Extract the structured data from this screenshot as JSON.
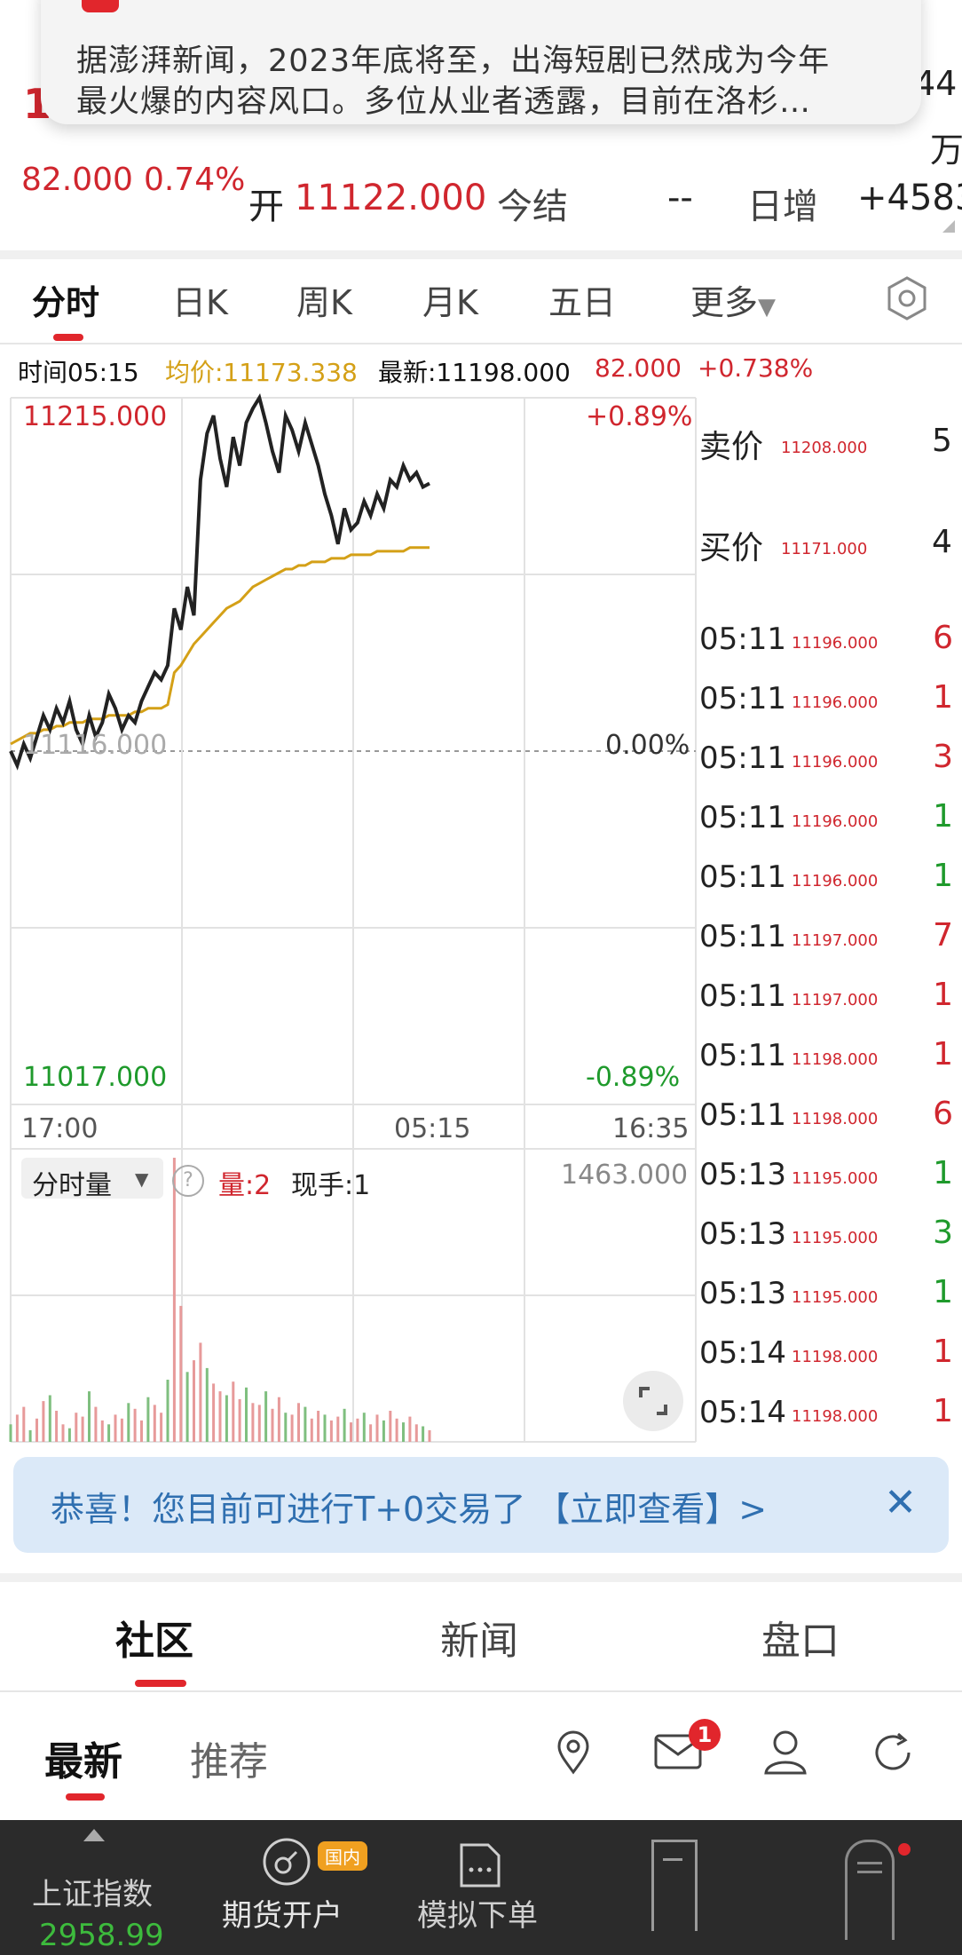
{
  "notification": {
    "line1": "据澎湃新闻，2023年底将至，出海短剧已然成为今年",
    "line2": "最火爆的内容风口。多位从业者透露，目前在洛杉…"
  },
  "quote": {
    "price_partial": "1",
    "change": "82.000",
    "change_pct": "0.74%",
    "right_top": "44",
    "right_mid": "万",
    "open_label": "开",
    "open_value": "11122.000",
    "settle_label": "今结",
    "settle_value": "--",
    "oi_label": "日增",
    "oi_value": "+4583"
  },
  "tabs": [
    "分时",
    "日K",
    "周K",
    "月K",
    "五日",
    "更多"
  ],
  "info_bar": {
    "time": "时间05:15",
    "avg": "均价:11173.338",
    "latest": "最新:11198.000",
    "change": "82.000",
    "change_pct": "+0.738%"
  },
  "chart_data": {
    "type": "line",
    "title": "",
    "x_ticks": [
      "17:00",
      "05:15",
      "16:35"
    ],
    "y_max": "11215.000",
    "y_min": "11017.000",
    "y_mid": "11116.000",
    "pct_max": "+0.89%",
    "pct_mid": "0.00%",
    "pct_min": "-0.89%",
    "ylim": [
      11017,
      11215
    ],
    "series": [
      {
        "color": "#222222",
        "values": [
          11116,
          11112,
          11118,
          11114,
          11120,
          11126,
          11122,
          11128,
          11124,
          11130,
          11122,
          11118,
          11126,
          11120,
          11124,
          11132,
          11128,
          11122,
          11126,
          11124,
          11130,
          11134,
          11138,
          11136,
          11140,
          11156,
          11150,
          11162,
          11154,
          11192,
          11205,
          11210,
          11198,
          11190,
          11204,
          11196,
          11208,
          11212,
          11215,
          11208,
          11200,
          11194,
          11210,
          11206,
          11200,
          11208,
          11202,
          11196,
          11188,
          11182,
          11174,
          11184,
          11178,
          11180,
          11186,
          11182,
          11188,
          11184,
          11192,
          11190,
          11196,
          11192,
          11194,
          11190,
          11191
        ]
      },
      {
        "color": "#d4a017",
        "values": [
          11118,
          11119,
          11120,
          11121,
          11121,
          11122,
          11122,
          11123,
          11123,
          11124,
          11124,
          11124,
          11125,
          11125,
          11125,
          11126,
          11126,
          11126,
          11126,
          11127,
          11127,
          11128,
          11128,
          11128,
          11129,
          11138,
          11140,
          11143,
          11146,
          11148,
          11150,
          11152,
          11154,
          11156,
          11157,
          11158,
          11160,
          11162,
          11163,
          11164,
          11165,
          11166,
          11167,
          11167,
          11168,
          11168,
          11169,
          11169,
          11169,
          11170,
          11170,
          11170,
          11171,
          11171,
          11171,
          11171,
          11172,
          11172,
          11172,
          11172,
          11172,
          11173,
          11173,
          11173,
          11173
        ]
      }
    ],
    "volume": {
      "label": "分时量",
      "qty_label": "量:2",
      "hand_label": "现手:1",
      "max_label": "1463.000",
      "values": [
        90,
        140,
        180,
        60,
        120,
        210,
        240,
        160,
        90,
        70,
        150,
        130,
        260,
        180,
        110,
        90,
        140,
        120,
        200,
        170,
        110,
        230,
        190,
        150,
        320,
        1463,
        700,
        360,
        420,
        510,
        380,
        300,
        260,
        240,
        310,
        220,
        280,
        200,
        190,
        260,
        170,
        230,
        150,
        140,
        200,
        180,
        120,
        160,
        140,
        110,
        130,
        170,
        100,
        120,
        150,
        90,
        140,
        110,
        160,
        120,
        100,
        130,
        90,
        80,
        60
      ]
    }
  },
  "order_book": {
    "ask_label": "卖价",
    "ask_price": "11208.000",
    "ask_vol": "5",
    "bid_label": "买价",
    "bid_price": "11171.000",
    "bid_vol": "4"
  },
  "trades": [
    {
      "time": "05:11",
      "price": "11196.000",
      "vol": "6",
      "color": "#d0262e"
    },
    {
      "time": "05:11",
      "price": "11196.000",
      "vol": "1",
      "color": "#d0262e"
    },
    {
      "time": "05:11",
      "price": "11196.000",
      "vol": "3",
      "color": "#d0262e"
    },
    {
      "time": "05:11",
      "price": "11196.000",
      "vol": "1",
      "color": "#1f9a2c"
    },
    {
      "time": "05:11",
      "price": "11196.000",
      "vol": "1",
      "color": "#1f9a2c"
    },
    {
      "time": "05:11",
      "price": "11197.000",
      "vol": "7",
      "color": "#d0262e"
    },
    {
      "time": "05:11",
      "price": "11197.000",
      "vol": "1",
      "color": "#d0262e"
    },
    {
      "time": "05:11",
      "price": "11198.000",
      "vol": "1",
      "color": "#d0262e"
    },
    {
      "time": "05:11",
      "price": "11198.000",
      "vol": "6",
      "color": "#d0262e"
    },
    {
      "time": "05:13",
      "price": "11195.000",
      "vol": "1",
      "color": "#1f9a2c"
    },
    {
      "time": "05:13",
      "price": "11195.000",
      "vol": "3",
      "color": "#1f9a2c"
    },
    {
      "time": "05:13",
      "price": "11195.000",
      "vol": "1",
      "color": "#1f9a2c"
    },
    {
      "time": "05:14",
      "price": "11198.000",
      "vol": "1",
      "color": "#d0262e"
    },
    {
      "time": "05:14",
      "price": "11198.000",
      "vol": "1",
      "color": "#d0262e"
    }
  ],
  "banner": {
    "message": "恭喜！您目前可进行T+0交易了 【立即查看】>"
  },
  "community_tabs": [
    "社区",
    "新闻",
    "盘口"
  ],
  "sub_tabs": [
    "最新",
    "推荐"
  ],
  "badge_count": "1",
  "bottom_bar": {
    "index_name": "上证指数",
    "index_value": "2958.99",
    "open_account": "期货开户",
    "domestic_badge": "国内",
    "sim_order": "模拟下单"
  },
  "colors": {
    "up": "#d0262e",
    "down": "#1f9a2c",
    "avg_line": "#d4a017",
    "accent": "#e1262c",
    "banner_text": "#2f6fb0"
  }
}
